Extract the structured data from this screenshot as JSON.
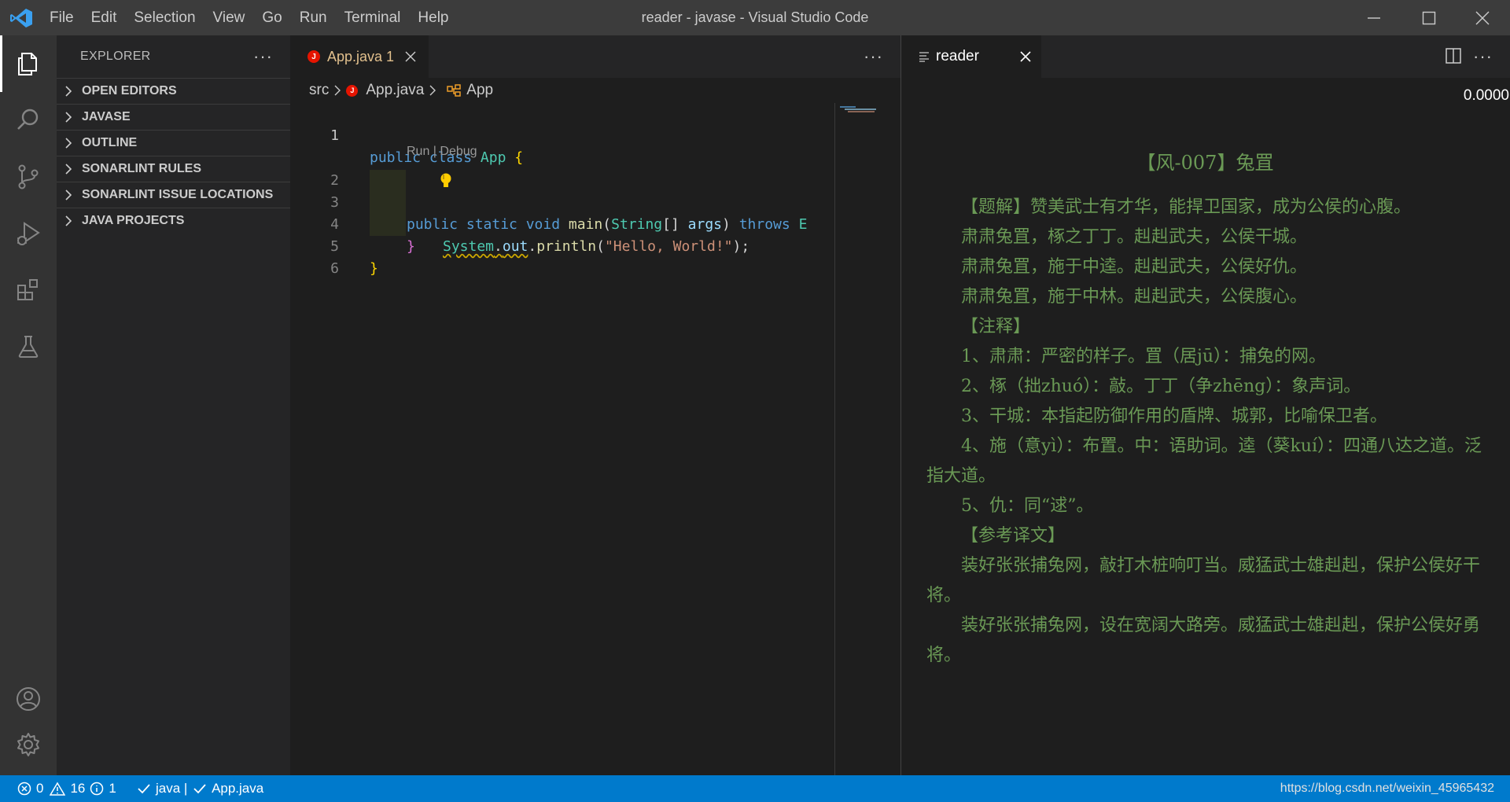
{
  "window": {
    "title": "reader - javase - Visual Studio Code"
  },
  "menu": [
    "File",
    "Edit",
    "Selection",
    "View",
    "Go",
    "Run",
    "Terminal",
    "Help"
  ],
  "activity_bar": {
    "icons": [
      "explorer-icon",
      "search-icon",
      "source-control-icon",
      "run-debug-icon",
      "extensions-icon",
      "testing-icon"
    ],
    "bottom_icons": [
      "accounts-icon",
      "settings-gear-icon"
    ]
  },
  "sidebar": {
    "title": "EXPLORER",
    "more": "···",
    "sections": [
      "OPEN EDITORS",
      "JAVASE",
      "OUTLINE",
      "SONARLINT RULES",
      "SONARLINT ISSUE LOCATIONS",
      "JAVA PROJECTS"
    ]
  },
  "editor": {
    "tab": {
      "label": "App.java 1",
      "icon_letter": "J"
    },
    "more": "···",
    "breadcrumb": [
      "src",
      "App.java",
      "App"
    ],
    "codelens": "Run | Debug",
    "line_numbers": [
      "1",
      "2",
      "3",
      "4",
      "5",
      "6"
    ],
    "code": {
      "l1_kw": "public class ",
      "l1_cls": "App",
      "l1_brace": " {",
      "l2_kw": "public static void ",
      "l2_fn": "main",
      "l2_p1": "(",
      "l2_cls": "String",
      "l2_p2": "[] ",
      "l2_var": "args",
      "l2_p3": ") ",
      "l2_throws": "throws ",
      "l2_trunc": "E",
      "l3_cls": "System",
      "l3_dot": ".",
      "l3_out": "out",
      "l3_dot2": ".",
      "l3_fn": "println",
      "l3_p1": "(",
      "l3_str": "\"Hello, World!\"",
      "l3_p2": ");",
      "l4": "}",
      "l5": "}"
    }
  },
  "reader": {
    "tab": {
      "label": "reader"
    },
    "more": "···",
    "progress": "0.0000",
    "title": "【风-007】兔罝",
    "paragraphs": [
      "【题解】赞美武士有才华，能捍卫国家，成为公侯的心腹。",
      "肃肃兔罝，椓之丁丁。赳赳武夫，公侯干城。",
      "肃肃兔罝，施于中逵。赳赳武夫，公侯好仇。",
      "肃肃兔罝，施于中林。赳赳武夫，公侯腹心。",
      "【注释】",
      "1、肃肃：严密的样子。罝（居jū）：捕兔的网。",
      "2、椓（拙zhuó）：敲。丁丁（争zhēng）：象声词。",
      "3、干城：本指起防御作用的盾牌、城郭，比喻保卫者。",
      "4、施（意yì）：布置。中：语助词。逵（葵kuí）：四通八达之道。泛指大道。",
      "5、仇：同“逑”。",
      "【参考译文】",
      "装好张张捕兔网，敲打木桩响叮当。威猛武士雄赳赳，保护公侯好干将。",
      "装好张张捕兔网，设在宽阔大路旁。威猛武士雄赳赳，保护公侯好勇将。"
    ]
  },
  "statusbar": {
    "errors": "0",
    "warnings": "16",
    "info": "1",
    "java_status": "java | ",
    "file_status": "App.java",
    "url": "https://blog.csdn.net/weixin_45965432"
  },
  "colors": {
    "titlebar": "#3c3c3c",
    "activitybar": "#333333",
    "sidebar": "#252526",
    "editor_bg": "#1e1e1e",
    "statusbar": "#007acc",
    "reader_text": "#6a9955",
    "tab_modified": "#e2c08d"
  }
}
